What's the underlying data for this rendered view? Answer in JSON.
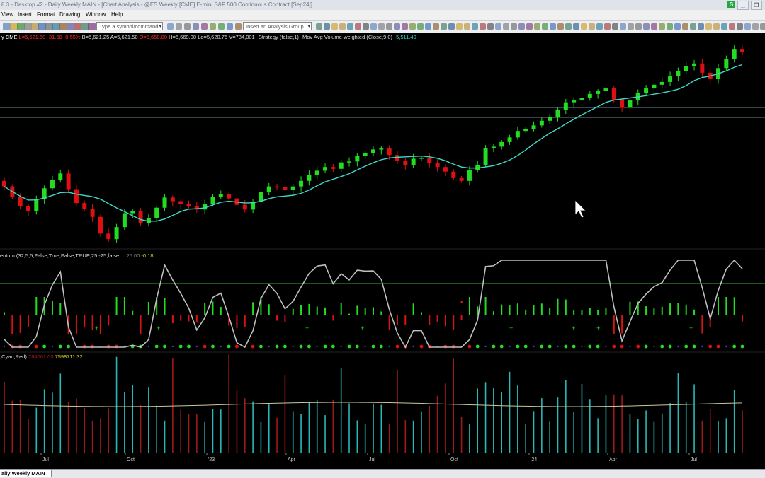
{
  "window": {
    "title": "8.3 - Desktop #2 - Daily Weekly MAIN - [Chart Analysis - @ES Weekly [CME] E-mini S&P 500 Continuous Contract [Sep24]]",
    "badge": "S",
    "minimize": "▁",
    "restore": "❐"
  },
  "menu": [
    "View",
    "Insert",
    "Format",
    "Drawing",
    "Window",
    "Help"
  ],
  "toolbar": {
    "symbol_placeholder": "Type a symbol/command",
    "analysis_group": "Insert an Analysis Group"
  },
  "status_line": {
    "symbol": "y CME",
    "last": "L=5,621.50",
    "net": "-31.50",
    "pct": "-0.55%",
    "bid": "B=5,621.25",
    "ask": "A=5,621.50",
    "open": "O=5,650.00",
    "high": "H=5,669.00",
    "low": "Lo=5,620.75",
    "volume": "V=784,001",
    "strategy": "Strategy (false,1)",
    "indicator": "Mov Avg Volume-weighted (Close,9,0)",
    "indicator_value": "5,511.40"
  },
  "momentum_label": {
    "name": "entum (32,5,5,False,True,False,TRUE,25,-25,false,...",
    "level": "25.00",
    "value": "-0.18"
  },
  "volume_label": {
    "name": ",Cyan,Red)",
    "value1": "784001.00",
    "value2": "759871​1.32"
  },
  "x_axis": [
    "Jul",
    "Oct",
    "'23",
    "Apr",
    "Jul",
    "Oct",
    "'24",
    "Apr",
    "Jul"
  ],
  "tab": "aily Weekly MAIN",
  "colors": {
    "up": "#22dd22",
    "down": "#dd1111",
    "vwma": "#40d8c8",
    "momentum_line": "#bfbfbf",
    "volume_up": "#2ab7b7",
    "volume_down": "#a01818",
    "volume_avg": "#c8c89a"
  },
  "chart_data": {
    "type": "candlestick",
    "symbol": "@ES Weekly",
    "price_panel": {
      "ohlc_approx_closes": [
        4170,
        4060,
        3960,
        3900,
        4030,
        4150,
        4240,
        4310,
        4140,
        3990,
        3930,
        3840,
        3660,
        3600,
        3730,
        3880,
        3900,
        3770,
        3830,
        3940,
        4050,
        4010,
        3980,
        3960,
        3920,
        3980,
        4060,
        4090,
        4040,
        3970,
        3920,
        4000,
        4110,
        4170,
        4160,
        4130,
        4170,
        4230,
        4290,
        4340,
        4380,
        4360,
        4430,
        4440,
        4500,
        4530,
        4570,
        4580,
        4510,
        4450,
        4400,
        4470,
        4480,
        4420,
        4380,
        4330,
        4260,
        4230,
        4350,
        4400,
        4580,
        4600,
        4650,
        4700,
        4770,
        4790,
        4830,
        4880,
        4920,
        5000,
        5080,
        5100,
        5130,
        5170,
        5200,
        5230,
        5110,
        5020,
        5100,
        5180,
        5230,
        5270,
        5300,
        5360,
        5420,
        5470,
        5500,
        5400,
        5330,
        5450,
        5550,
        5650,
        5620
      ],
      "indicator": "Mov Avg Volume-weighted (Close,9,0)",
      "indicator_last": 5511.4
    },
    "momentum_panel": {
      "level_high": 25,
      "level_low": -25,
      "last": -0.18
    },
    "volume_panel": {
      "last_volume": 784001,
      "avg": 7598711.32
    }
  }
}
